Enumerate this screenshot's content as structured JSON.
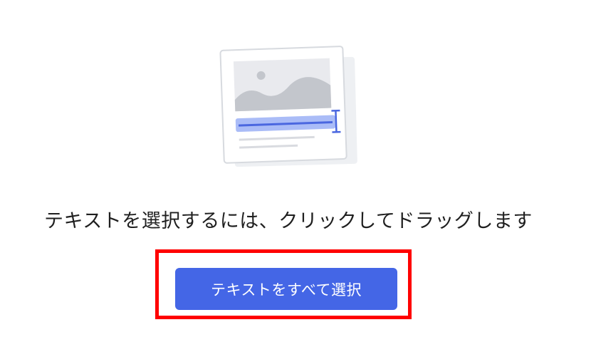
{
  "instruction": {
    "text": "テキストを選択するには、クリックしてドラッグします"
  },
  "action": {
    "select_all_label": "テキストをすべて選択"
  },
  "illustration": {
    "icon": "text-selection-illustration-icon"
  },
  "colors": {
    "button_bg": "#4466e6",
    "highlight_frame": "#ff0000",
    "selection_fill": "#aabcf7",
    "selection_line": "#4a67e0"
  }
}
